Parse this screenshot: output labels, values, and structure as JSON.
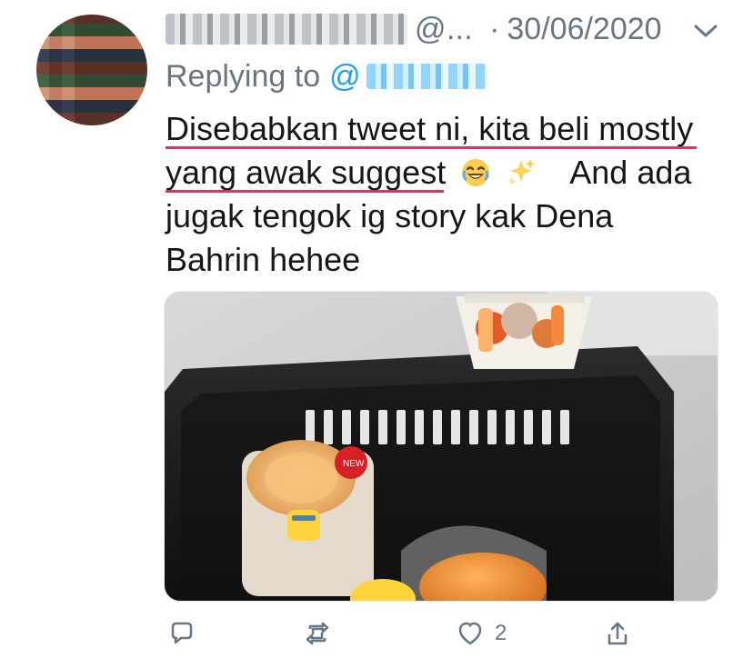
{
  "tweet": {
    "header": {
      "handle_partial": "@...",
      "date": "30/06/2020"
    },
    "replying": {
      "prefix": "Replying to",
      "mention_prefix": "@"
    },
    "text": {
      "line1": "Disebabkan tweet ni, kita beli mostly",
      "line2a": "yang awak suggest",
      "line2b": "And ada",
      "line3": "jugak tengok ig story kak Dena",
      "line4": "Bahrin hehee"
    },
    "actions": {
      "reply_icon": "reply-icon",
      "retweet_icon": "retweet-icon",
      "like_icon": "heart-icon",
      "like_count": "2",
      "share_icon": "share-icon"
    },
    "colors": {
      "meta_gray": "#657786",
      "mention_blue": "#1da1f2",
      "underline_red": "#e0245e"
    }
  }
}
